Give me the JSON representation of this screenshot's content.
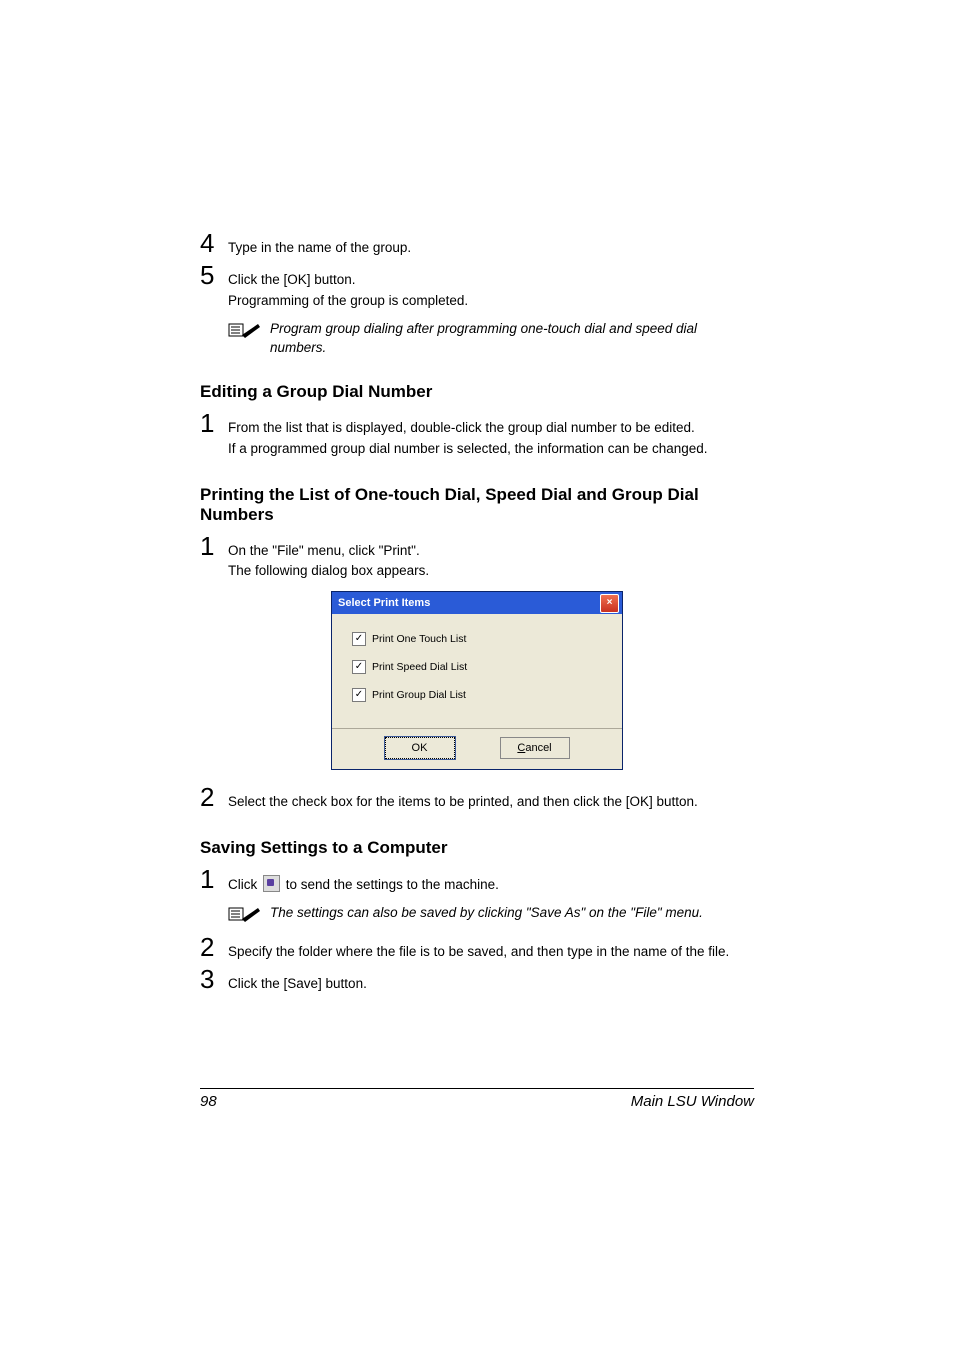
{
  "steps_top": {
    "s4": {
      "num": "4",
      "text": "Type in the name of the group."
    },
    "s5": {
      "num": "5",
      "text1": "Click the [OK] button.",
      "text2": "Programming of the group is completed."
    }
  },
  "note1": "Program group dialing after programming one-touch dial and speed dial numbers.",
  "heading_edit": "Editing a Group Dial Number",
  "edit_step1": {
    "num": "1",
    "text1": "From the list that is displayed, double-click the group dial number to be edited.",
    "text2": "If a programmed group dial number is selected, the information can be changed."
  },
  "heading_print": "Printing the List of One-touch Dial, Speed Dial and Group Dial Numbers",
  "print_step1": {
    "num": "1",
    "text1": "On the \"File\" menu, click \"Print\".",
    "text2": "The following dialog box appears."
  },
  "dialog": {
    "title": "Select Print Items",
    "close": "×",
    "checks": [
      {
        "label": "Print One Touch List",
        "checked": true
      },
      {
        "label": "Print Speed Dial List",
        "checked": true
      },
      {
        "label": "Print Group Dial List",
        "checked": true
      }
    ],
    "ok": "OK",
    "cancel": "Cancel"
  },
  "print_step2": {
    "num": "2",
    "text": "Select the check box for the items to be printed, and then click the [OK] button."
  },
  "heading_save": "Saving Settings to a Computer",
  "save_step1": {
    "num": "1",
    "pre": "Click ",
    "post": " to send the settings to the machine."
  },
  "note2": "The settings can also be saved by clicking \"Save As\" on the \"File\" menu.",
  "save_step2": {
    "num": "2",
    "text": "Specify the folder where the file is to be saved, and then type in the name of the file."
  },
  "save_step3": {
    "num": "3",
    "text": "Click the [Save] button."
  },
  "footer": {
    "page": "98",
    "title": "Main LSU Window"
  }
}
